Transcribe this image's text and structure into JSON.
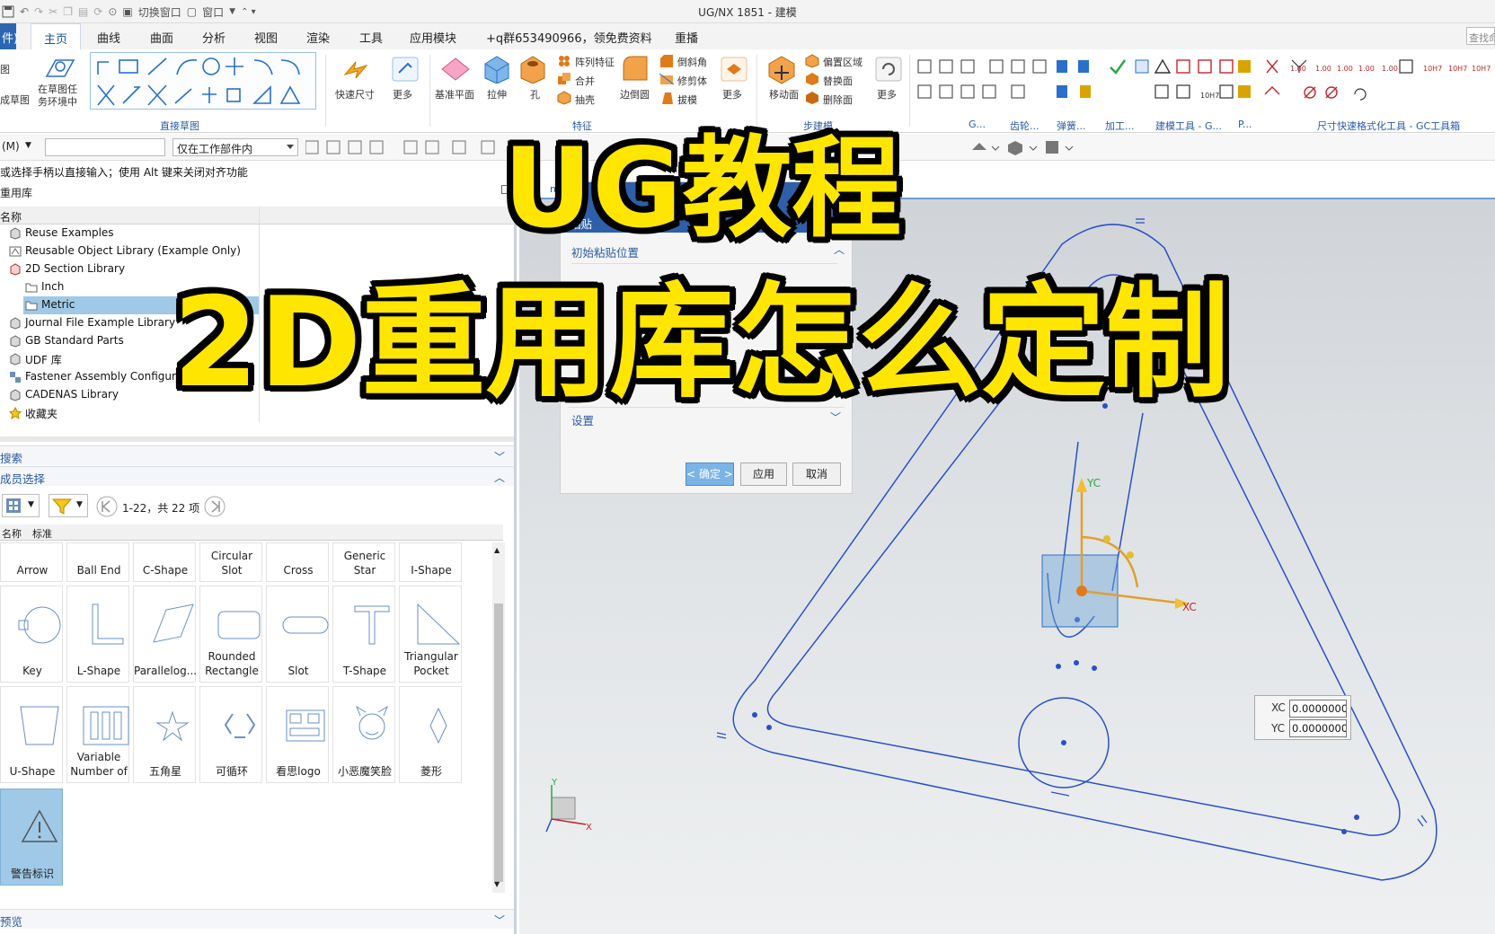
{
  "window": {
    "title": "UG/NX 1851 - 建模",
    "quick_access": [
      "切换窗口",
      "窗口"
    ]
  },
  "menu": {
    "file_label": "件)",
    "tabs": [
      "主页",
      "曲线",
      "曲面",
      "分析",
      "视图",
      "渲染",
      "工具",
      "应用模块",
      "+q群653490966，领免费资料",
      "重播"
    ],
    "active_tab": "主页",
    "command_search_placeholder": "查找命"
  },
  "ribbon": {
    "sketch_group": {
      "cut_label_1": "图",
      "cut_label_2": "成草图",
      "on_face_sketch": "在草图任\n务环境中",
      "group_label": "直接草图"
    },
    "quick_dim": "快速尺寸",
    "more": "更多",
    "feature_group": {
      "datum_plane": "基准平面",
      "extrude": "拉伸",
      "hole": "孔",
      "pattern": "阵列特征",
      "unite": "合并",
      "shell": "抽壳",
      "edge_blend": "边倒圆",
      "chamfer": "倒斜角",
      "trim_body": "修剪体",
      "draft": "拔模",
      "more": "更多",
      "group_label": "特征"
    },
    "sync_group": {
      "move_face": "移动面",
      "offset_region": "偏置区域",
      "replace_face": "替换面",
      "delete_face": "删除面",
      "more": "更多",
      "group_label": "步建模"
    },
    "right_groups": {
      "g1": "G...",
      "gear": "齿轮...",
      "spring": "弹簧...",
      "machining": "加工...",
      "build_tools": "建模工具 - G...",
      "p": "P...",
      "dim_format": "尺寸快速格式化工具 - GC工具箱"
    }
  },
  "toolbar2": {
    "menu_label": "(M)",
    "filter_value": "",
    "scope_value": "仅在工作部件内"
  },
  "cue_line": "或选择手柄以直接输入；使用 Alt 键来关闭对齐功能",
  "panel": {
    "title": "重用库",
    "column_name": "名称",
    "tree": [
      {
        "label": "Reuse Examples",
        "indent": 0,
        "icon": "library-icon"
      },
      {
        "label": "Reusable Object Library (Example Only)",
        "indent": 0,
        "icon": "object-library-icon"
      },
      {
        "label": "2D Section Library",
        "indent": 0,
        "icon": "section-library-icon"
      },
      {
        "label": "Inch",
        "indent": 1,
        "icon": "folder-icon"
      },
      {
        "label": "Metric",
        "indent": 1,
        "icon": "folder-icon",
        "selected": true
      },
      {
        "label": "Journal File Example Library",
        "indent": 0,
        "icon": "library-icon"
      },
      {
        "label": "GB Standard Parts",
        "indent": 0,
        "icon": "library-icon"
      },
      {
        "label": "UDF 库",
        "indent": 0,
        "icon": "library-icon"
      },
      {
        "label": "Fastener Assembly Configurati",
        "indent": 0,
        "icon": "fastener-icon"
      },
      {
        "label": "CADENAS Library",
        "indent": 0,
        "icon": "library-icon"
      },
      {
        "label": "收藏夹",
        "indent": 0,
        "icon": "star-icon"
      }
    ],
    "search_section": "搜索",
    "member_section": "成员选择",
    "paging_text": "1-22，共 22 项",
    "tabs_small": [
      "名称",
      "标准"
    ],
    "members": [
      {
        "label": "Arrow"
      },
      {
        "label": "Ball End"
      },
      {
        "label": "C-Shape"
      },
      {
        "label": "Circular\nSlot"
      },
      {
        "label": "Cross"
      },
      {
        "label": "Generic\nStar"
      },
      {
        "label": "I-Shape"
      },
      {
        "label": "Key"
      },
      {
        "label": "L-Shape"
      },
      {
        "label": "Parallelog..."
      },
      {
        "label": "Rounded\nRectangle"
      },
      {
        "label": "Slot"
      },
      {
        "label": "T-Shape"
      },
      {
        "label": "Triangular\nPocket"
      },
      {
        "label": "U-Shape"
      },
      {
        "label": "Variable\nNumber of"
      },
      {
        "label": "五角星"
      },
      {
        "label": "可循环"
      },
      {
        "label": "看思logo"
      },
      {
        "label": "小恶魔笑脸"
      },
      {
        "label": "菱形"
      },
      {
        "label": "警告标识",
        "selected": true
      }
    ],
    "preview_section": "预览"
  },
  "dialog": {
    "title_fragment": "粘贴",
    "initial_position": "初始粘贴位置",
    "settings": "设置",
    "ok": "< 确定 >",
    "apply": "应用",
    "cancel": "取消"
  },
  "graphics": {
    "tab_fragment": "m",
    "coord": {
      "xc_label": "XC",
      "yc_label": "YC",
      "xc_value": "0.0000000",
      "yc_value": "0.0000000"
    },
    "triad": {
      "y": "YC",
      "x": "XC"
    },
    "wcs": {
      "y": "Y",
      "x": "X"
    }
  },
  "overlay": {
    "line1": "UG教程",
    "line2": "2D重用库怎么定制",
    "color": "#ffe600"
  },
  "colors": {
    "accent_blue": "#2a5aa5",
    "selection": "#9fc9e6",
    "sketch_blue": "#2a4fc8"
  }
}
